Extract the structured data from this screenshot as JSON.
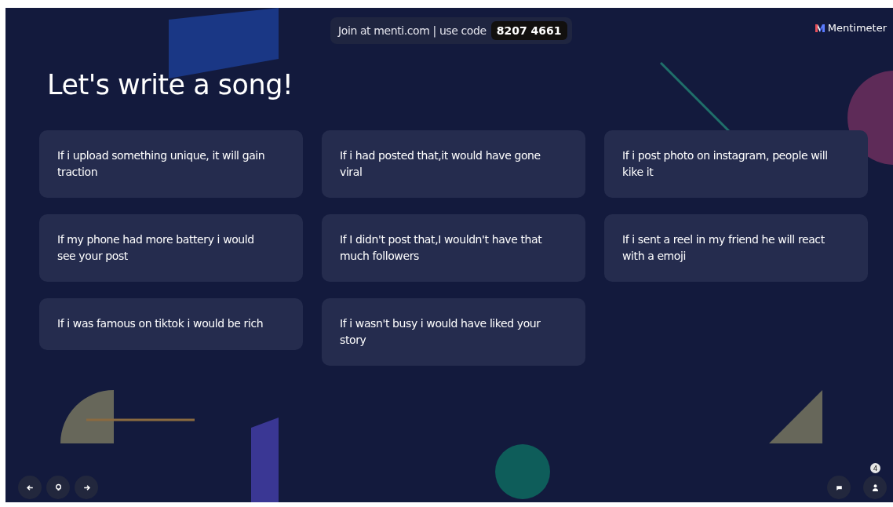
{
  "join_bar": {
    "text": "Join at menti.com | use code",
    "code": "8207 4661"
  },
  "logo": {
    "text": "Mentimeter"
  },
  "title": "Let's write a song!",
  "responses": [
    {
      "text": "If i upload something unique, it will gain traction"
    },
    {
      "text": "If i had posted that,it would have gone viral"
    },
    {
      "text": "If i post photo on instagram, people will kike it"
    },
    {
      "text": "If my phone had more battery i would see your post"
    },
    {
      "text": "If I didn't post that,I wouldn't have that much followers"
    },
    {
      "text": "If i sent a reel in my friend he will react with a emoji"
    },
    {
      "text": "If i was famous on tiktok i would be rich"
    },
    {
      "text": "If i wasn't busy i would have liked your story"
    }
  ],
  "participants_count": "4"
}
